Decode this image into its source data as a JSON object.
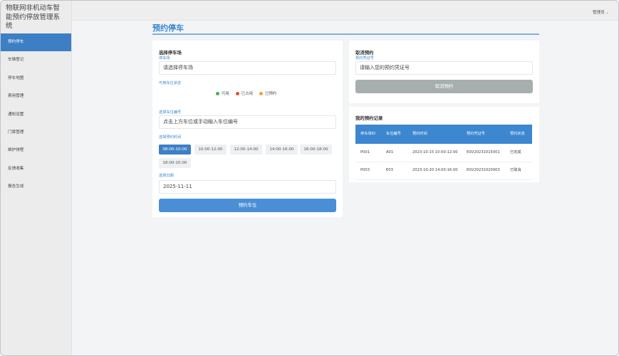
{
  "app": {
    "title_line1": "物联网非机动车智",
    "title_line2": "能预约停放管理系",
    "title_line3": "统"
  },
  "sidebar": {
    "items": [
      {
        "label": "预约停车",
        "active": true
      },
      {
        "label": "车辆登记"
      },
      {
        "label": "停车地图"
      },
      {
        "label": "费用管理"
      },
      {
        "label": "通知设置"
      },
      {
        "label": "门禁管理"
      },
      {
        "label": "维护排程"
      },
      {
        "label": "反馈收集"
      },
      {
        "label": "报告生成"
      }
    ]
  },
  "topbar": {
    "user_label": "管理员",
    "caret": "⌄"
  },
  "page": {
    "title": "预约停车"
  },
  "booking": {
    "section_title": "选择停车场",
    "lot_label": "停车场",
    "lot_value": "请选择停车场",
    "status_label": "可用车位状态",
    "legend": [
      {
        "label": "可用",
        "color": "#4caf50"
      },
      {
        "label": "已占用",
        "color": "#e0533a"
      },
      {
        "label": "已预约",
        "color": "#f0a030"
      }
    ],
    "space_label": "选择车位编号",
    "space_placeholder": "点击上方车位或手动输入车位编号",
    "time_label": "选择预约时间",
    "slots": [
      "08:00-10:00",
      "10:00-12:00",
      "12:00-14:00",
      "14:00-16:00",
      "16:00-18:00",
      "18:00-20:00"
    ],
    "selected_slot": "08:00-10:00",
    "date_label": "选择日期",
    "date_value": "2025-11-11",
    "submit_label": "预约车位"
  },
  "cancel": {
    "section_title": "取消预约",
    "code_label": "预约凭证号",
    "code_placeholder": "请输入您的预约凭证号",
    "button_label": "取消预约"
  },
  "records": {
    "section_title": "我的预约记录",
    "columns": [
      "停车场ID",
      "车位编号",
      "预约时间",
      "预约凭证号",
      "预约状态"
    ],
    "rows": [
      [
        "P001",
        "A01",
        "2023-10-15 10:00-12:00",
        "RSV20231015001",
        "已完成"
      ],
      [
        "P003",
        "E03",
        "2023-10-20 14:00-16:00",
        "RSV20231020003",
        "已取消"
      ]
    ]
  }
}
